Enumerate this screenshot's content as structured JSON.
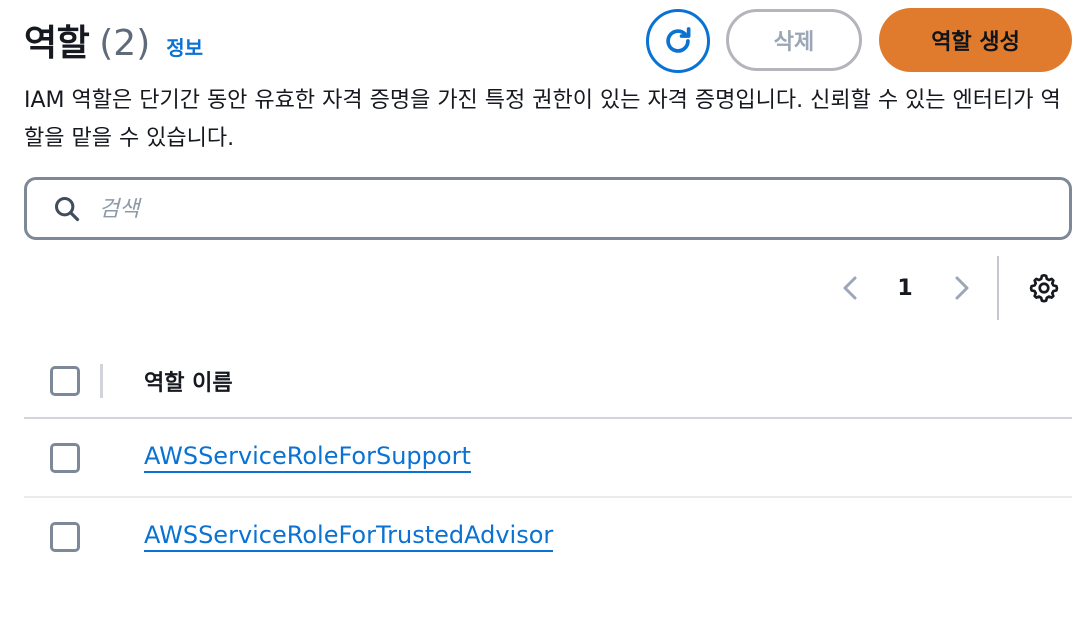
{
  "header": {
    "title": "역할",
    "count": "(2)",
    "info_link": "정보",
    "delete_label": "삭제",
    "create_label": "역할 생성"
  },
  "description": "IAM 역할은 단기간 동안 유효한 자격 증명을 가진 특정 권한이 있는 자격 증명입니다. 신뢰할 수 있는 엔터티가 역할을 맡을 수 있습니다.",
  "search": {
    "placeholder": "검색",
    "value": ""
  },
  "pagination": {
    "current_page": "1"
  },
  "table": {
    "columns": [
      "역할 이름"
    ],
    "rows": [
      {
        "role_name": "AWSServiceRoleForSupport"
      },
      {
        "role_name": "AWSServiceRoleForTrustedAdvisor"
      }
    ]
  },
  "colors": {
    "primary_link": "#0972d3",
    "create_button": "#e07b2e",
    "disabled_text": "#9ba7b6",
    "border": "#7d8998"
  },
  "icons": {
    "refresh": "refresh-icon",
    "search": "search-icon",
    "prev": "chevron-left-icon",
    "next": "chevron-right-icon",
    "settings": "gear-icon"
  }
}
